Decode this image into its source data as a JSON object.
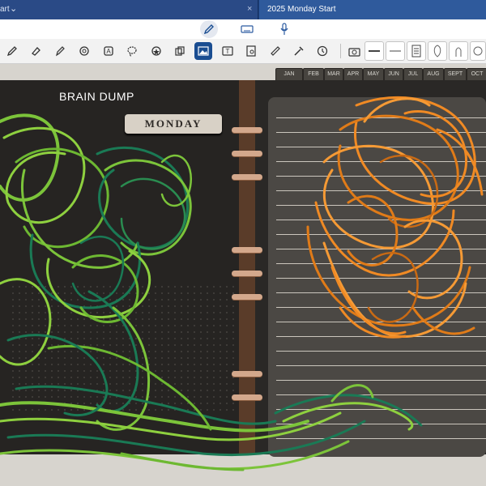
{
  "tabs": [
    {
      "label": "art"
    },
    {
      "label": "2025 Monday Start"
    }
  ],
  "modes": [
    {
      "name": "pen-mode-icon"
    },
    {
      "name": "keyboard-mode-icon"
    },
    {
      "name": "mic-mode-icon"
    }
  ],
  "toolbar": {
    "tools": [
      "pen-icon",
      "eraser-icon",
      "highlighter-icon",
      "shape-icon",
      "lasso-icon",
      "sticker-icon",
      "copy-icon",
      "image-icon",
      "text-icon",
      "scan-icon",
      "ruler-icon",
      "laser-icon",
      "history-icon",
      "camera-icon"
    ],
    "active_tool": "image-icon"
  },
  "planner": {
    "months": [
      "JAN",
      "FEB",
      "MAR",
      "APR",
      "MAY",
      "JUN",
      "JUL",
      "AUG",
      "SEPT",
      "OCT"
    ],
    "left_heading": "BRAIN DUMP",
    "day_tab": "MONDAY"
  },
  "colors": {
    "tabbar": "#1e3e79",
    "active_tool": "#1a4d91",
    "page_dark": "#262422",
    "spine": "#5a3c29",
    "scribble_green_light": "#7cc43a",
    "scribble_green_dark": "#1a7a55",
    "scribble_orange": "#f08a24"
  }
}
